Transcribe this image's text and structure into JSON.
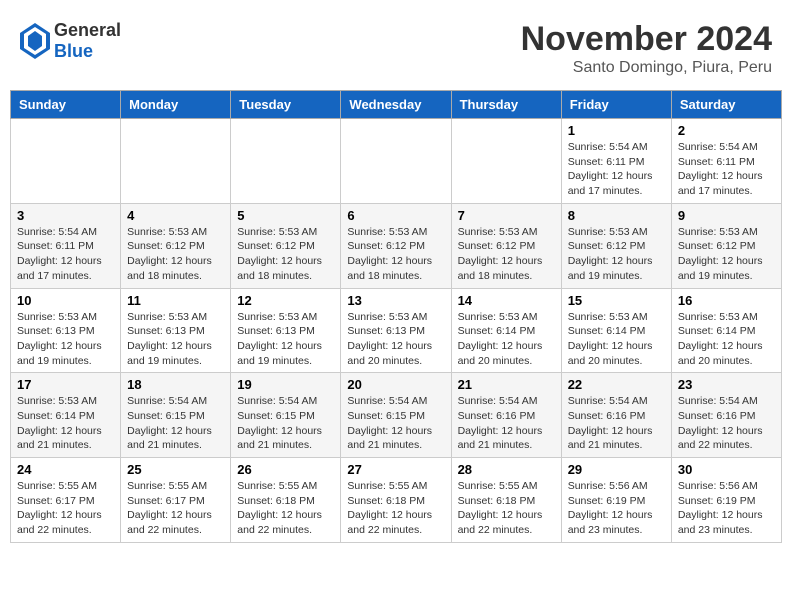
{
  "logo": {
    "general": "General",
    "blue": "Blue"
  },
  "header": {
    "month": "November 2024",
    "location": "Santo Domingo, Piura, Peru"
  },
  "weekdays": [
    "Sunday",
    "Monday",
    "Tuesday",
    "Wednesday",
    "Thursday",
    "Friday",
    "Saturday"
  ],
  "weeks": [
    [
      {
        "day": "",
        "info": ""
      },
      {
        "day": "",
        "info": ""
      },
      {
        "day": "",
        "info": ""
      },
      {
        "day": "",
        "info": ""
      },
      {
        "day": "",
        "info": ""
      },
      {
        "day": "1",
        "info": "Sunrise: 5:54 AM\nSunset: 6:11 PM\nDaylight: 12 hours and 17 minutes."
      },
      {
        "day": "2",
        "info": "Sunrise: 5:54 AM\nSunset: 6:11 PM\nDaylight: 12 hours and 17 minutes."
      }
    ],
    [
      {
        "day": "3",
        "info": "Sunrise: 5:54 AM\nSunset: 6:11 PM\nDaylight: 12 hours and 17 minutes."
      },
      {
        "day": "4",
        "info": "Sunrise: 5:53 AM\nSunset: 6:12 PM\nDaylight: 12 hours and 18 minutes."
      },
      {
        "day": "5",
        "info": "Sunrise: 5:53 AM\nSunset: 6:12 PM\nDaylight: 12 hours and 18 minutes."
      },
      {
        "day": "6",
        "info": "Sunrise: 5:53 AM\nSunset: 6:12 PM\nDaylight: 12 hours and 18 minutes."
      },
      {
        "day": "7",
        "info": "Sunrise: 5:53 AM\nSunset: 6:12 PM\nDaylight: 12 hours and 18 minutes."
      },
      {
        "day": "8",
        "info": "Sunrise: 5:53 AM\nSunset: 6:12 PM\nDaylight: 12 hours and 19 minutes."
      },
      {
        "day": "9",
        "info": "Sunrise: 5:53 AM\nSunset: 6:12 PM\nDaylight: 12 hours and 19 minutes."
      }
    ],
    [
      {
        "day": "10",
        "info": "Sunrise: 5:53 AM\nSunset: 6:13 PM\nDaylight: 12 hours and 19 minutes."
      },
      {
        "day": "11",
        "info": "Sunrise: 5:53 AM\nSunset: 6:13 PM\nDaylight: 12 hours and 19 minutes."
      },
      {
        "day": "12",
        "info": "Sunrise: 5:53 AM\nSunset: 6:13 PM\nDaylight: 12 hours and 19 minutes."
      },
      {
        "day": "13",
        "info": "Sunrise: 5:53 AM\nSunset: 6:13 PM\nDaylight: 12 hours and 20 minutes."
      },
      {
        "day": "14",
        "info": "Sunrise: 5:53 AM\nSunset: 6:14 PM\nDaylight: 12 hours and 20 minutes."
      },
      {
        "day": "15",
        "info": "Sunrise: 5:53 AM\nSunset: 6:14 PM\nDaylight: 12 hours and 20 minutes."
      },
      {
        "day": "16",
        "info": "Sunrise: 5:53 AM\nSunset: 6:14 PM\nDaylight: 12 hours and 20 minutes."
      }
    ],
    [
      {
        "day": "17",
        "info": "Sunrise: 5:53 AM\nSunset: 6:14 PM\nDaylight: 12 hours and 21 minutes."
      },
      {
        "day": "18",
        "info": "Sunrise: 5:54 AM\nSunset: 6:15 PM\nDaylight: 12 hours and 21 minutes."
      },
      {
        "day": "19",
        "info": "Sunrise: 5:54 AM\nSunset: 6:15 PM\nDaylight: 12 hours and 21 minutes."
      },
      {
        "day": "20",
        "info": "Sunrise: 5:54 AM\nSunset: 6:15 PM\nDaylight: 12 hours and 21 minutes."
      },
      {
        "day": "21",
        "info": "Sunrise: 5:54 AM\nSunset: 6:16 PM\nDaylight: 12 hours and 21 minutes."
      },
      {
        "day": "22",
        "info": "Sunrise: 5:54 AM\nSunset: 6:16 PM\nDaylight: 12 hours and 21 minutes."
      },
      {
        "day": "23",
        "info": "Sunrise: 5:54 AM\nSunset: 6:16 PM\nDaylight: 12 hours and 22 minutes."
      }
    ],
    [
      {
        "day": "24",
        "info": "Sunrise: 5:55 AM\nSunset: 6:17 PM\nDaylight: 12 hours and 22 minutes."
      },
      {
        "day": "25",
        "info": "Sunrise: 5:55 AM\nSunset: 6:17 PM\nDaylight: 12 hours and 22 minutes."
      },
      {
        "day": "26",
        "info": "Sunrise: 5:55 AM\nSunset: 6:18 PM\nDaylight: 12 hours and 22 minutes."
      },
      {
        "day": "27",
        "info": "Sunrise: 5:55 AM\nSunset: 6:18 PM\nDaylight: 12 hours and 22 minutes."
      },
      {
        "day": "28",
        "info": "Sunrise: 5:55 AM\nSunset: 6:18 PM\nDaylight: 12 hours and 22 minutes."
      },
      {
        "day": "29",
        "info": "Sunrise: 5:56 AM\nSunset: 6:19 PM\nDaylight: 12 hours and 23 minutes."
      },
      {
        "day": "30",
        "info": "Sunrise: 5:56 AM\nSunset: 6:19 PM\nDaylight: 12 hours and 23 minutes."
      }
    ]
  ]
}
